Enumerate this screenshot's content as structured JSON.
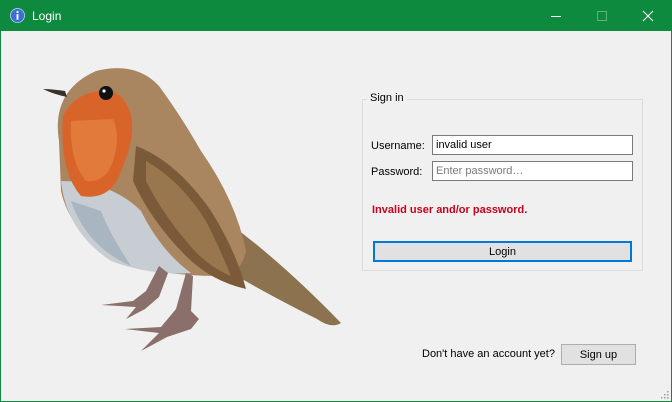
{
  "window": {
    "title": "Login",
    "app_icon": "info-icon",
    "controls": [
      "minimize-icon",
      "maximize-icon",
      "close-icon"
    ],
    "accent_color": "#0e8a3e"
  },
  "illustration": "robin-bird-image",
  "signin": {
    "group_title": "Sign in",
    "username_label": "Username:",
    "username_value": "invalid user",
    "password_label": "Password:",
    "password_placeholder": "Enter password…",
    "error_message": "Invalid user and/or password.",
    "error_color": "#c8001e",
    "login_label": "Login"
  },
  "footer": {
    "prompt": "Don't have an account yet?",
    "signup_label": "Sign up"
  }
}
